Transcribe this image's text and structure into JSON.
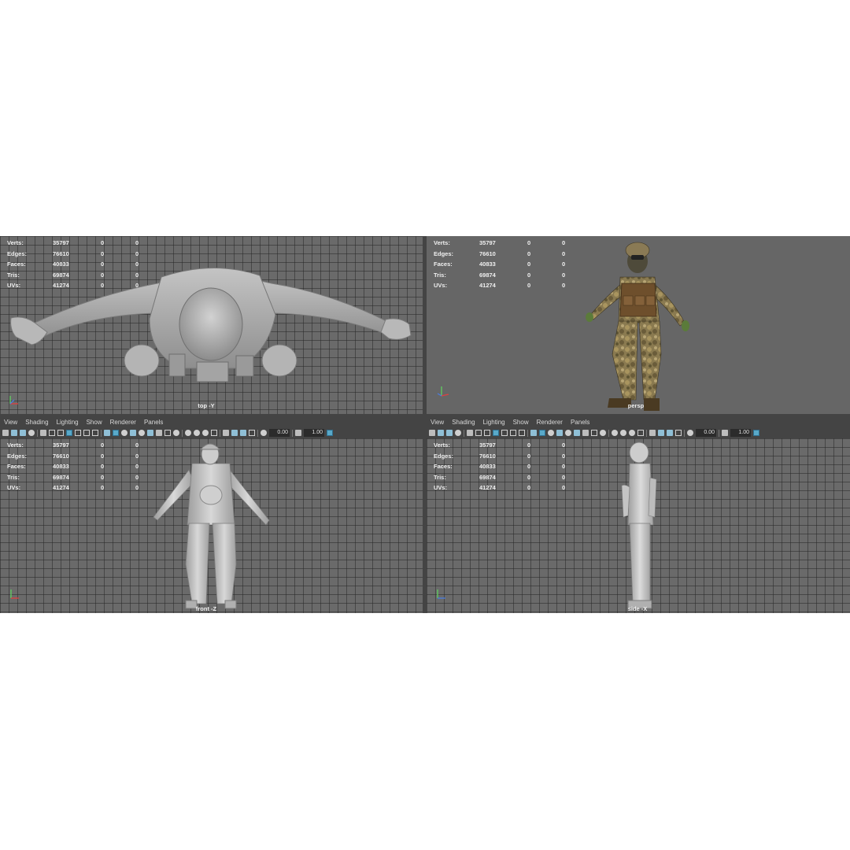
{
  "stats": {
    "labels": [
      "Verts:",
      "Edges:",
      "Faces:",
      "Tris:",
      "UVs:"
    ],
    "values": [
      [
        "35797",
        "0",
        "0"
      ],
      [
        "76610",
        "0",
        "0"
      ],
      [
        "40833",
        "0",
        "0"
      ],
      [
        "69874",
        "0",
        "0"
      ],
      [
        "41274",
        "0",
        "0"
      ]
    ]
  },
  "panel_menu": [
    "View",
    "Shading",
    "Lighting",
    "Show",
    "Renderer",
    "Panels"
  ],
  "toolbar": {
    "field_a": "0.00",
    "field_b": "1.00"
  },
  "viewports": [
    {
      "camera": "top -Y"
    },
    {
      "camera": "persp"
    },
    {
      "camera": "front -Z"
    },
    {
      "camera": "side -X"
    }
  ],
  "colors": {
    "grid_bg": "#6a6a6a",
    "persp_bg": "#666666",
    "panel_bg": "#444444",
    "model_grey": "#c8c8c8",
    "camo_base": "#8a7a50",
    "vest": "#6e4f2c",
    "gloves": "#5b7b3a"
  }
}
